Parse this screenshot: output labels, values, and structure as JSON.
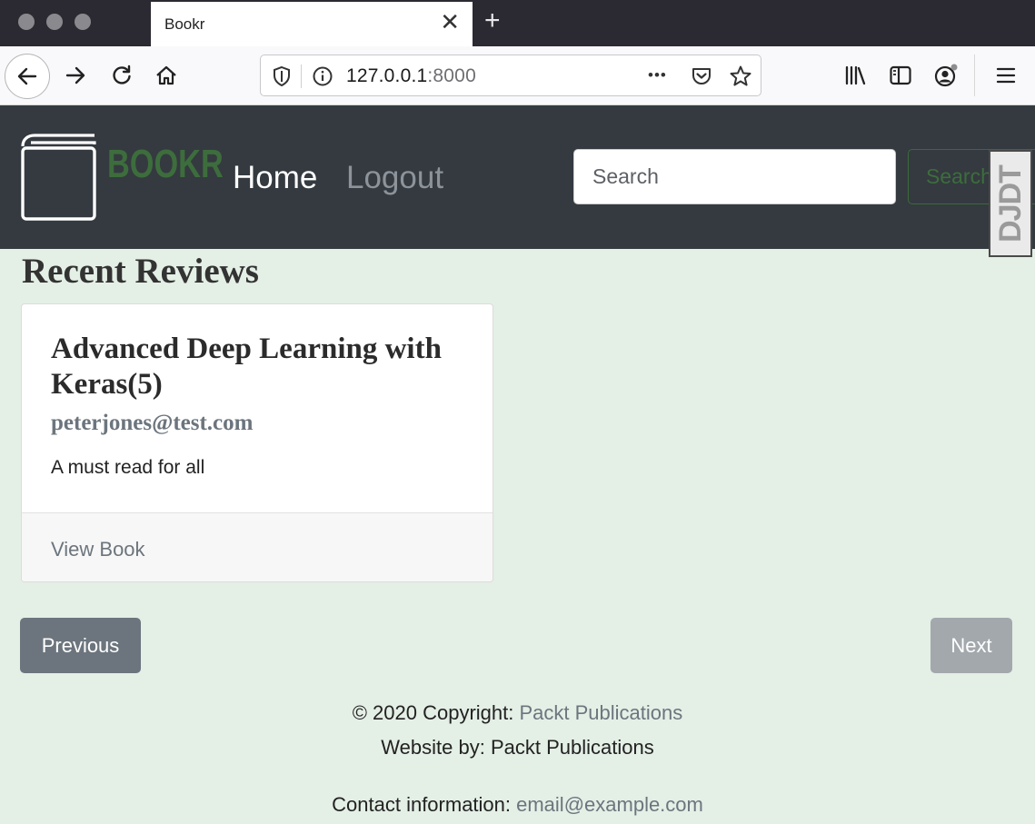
{
  "browser": {
    "tab_title": "Bookr",
    "tab_close_glyph": "✕",
    "new_tab_glyph": "+",
    "url_host": "127.0.0.1",
    "url_port": ":8000",
    "url_more_glyph": "•••",
    "icons": [
      "back-arrow-icon",
      "forward-arrow-icon",
      "reload-icon",
      "home-icon",
      "shield-icon",
      "info-icon",
      "pocket-icon",
      "bookmark-star-icon",
      "library-icon",
      "sidebar-icon",
      "account-icon",
      "hamburger-menu-icon"
    ]
  },
  "site": {
    "brand": "BOOKR",
    "nav": {
      "home": "Home",
      "logout": "Logout"
    },
    "search": {
      "placeholder": "Search",
      "button": "Search"
    },
    "djdt_label": "DJDT"
  },
  "main": {
    "heading": "Recent Reviews",
    "reviews": [
      {
        "title": "Advanced Deep Learning with Keras(5)",
        "creator": "peterjones@test.com",
        "content": "A must read for all",
        "link": "View Book"
      }
    ],
    "pagination": {
      "previous": "Previous",
      "next": "Next"
    }
  },
  "footer": {
    "copyright_prefix": "© 2020 Copyright: ",
    "copyright_link": "Packt Publications",
    "website_by": "Website by: Packt Publications",
    "contact_prefix": "Contact information: ",
    "contact_email": "email@example.com"
  },
  "colors": {
    "page_bg": "#e4efe6",
    "header_bg": "#343a40",
    "brand": "#3d6d3c",
    "muted": "#6c757d"
  }
}
